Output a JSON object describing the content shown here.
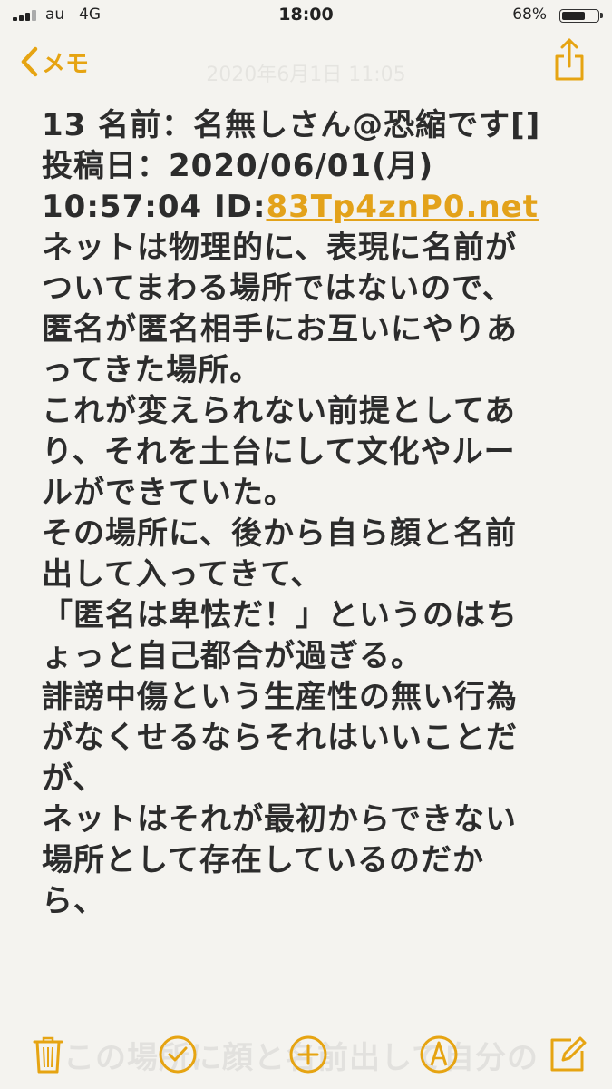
{
  "status_bar": {
    "carrier": "au",
    "network": "4G",
    "time": "18:00",
    "battery_percent_text": "68%",
    "battery_level": 0.68
  },
  "nav": {
    "back_label": "メモ",
    "faded_date": "2020年6月1日 11:05"
  },
  "note": {
    "header_line1": "13 名前：名無しさん@恐縮です[]",
    "header_line2": "投稿日：2020/06/01(月)",
    "time_id_prefix": "10:57:04 ID:",
    "id_link": "83Tp4znP0.net",
    "body_lines": [
      "ネットは物理的に、表現に名前が",
      "ついてまわる場所ではないので、",
      "匿名が匿名相手にお互いにやりあ",
      "ってきた場所。",
      "これが変えられない前提としてあ",
      "り、それを土台にして文化やルー",
      "ルができていた。",
      "その場所に、後から自ら顔と名前",
      "出して入ってきて、",
      "「匿名は卑怯だ！」というのはち",
      "ょっと自己都合が過ぎる。",
      "誹謗中傷という生産性の無い行為",
      "がなくせるならそれはいいことだ",
      "が、",
      "ネットはそれが最初からできない",
      "場所として存在しているのだか",
      "ら、"
    ],
    "ghost_line": "この場所に顔と名前出して自分の"
  },
  "colors": {
    "accent": "#e6a412",
    "background": "#f4f3ef",
    "text": "#2c2c2c"
  },
  "toolbar": {
    "icons": [
      "trash-icon",
      "checklist-icon",
      "add-icon",
      "markup-icon",
      "compose-icon"
    ]
  }
}
